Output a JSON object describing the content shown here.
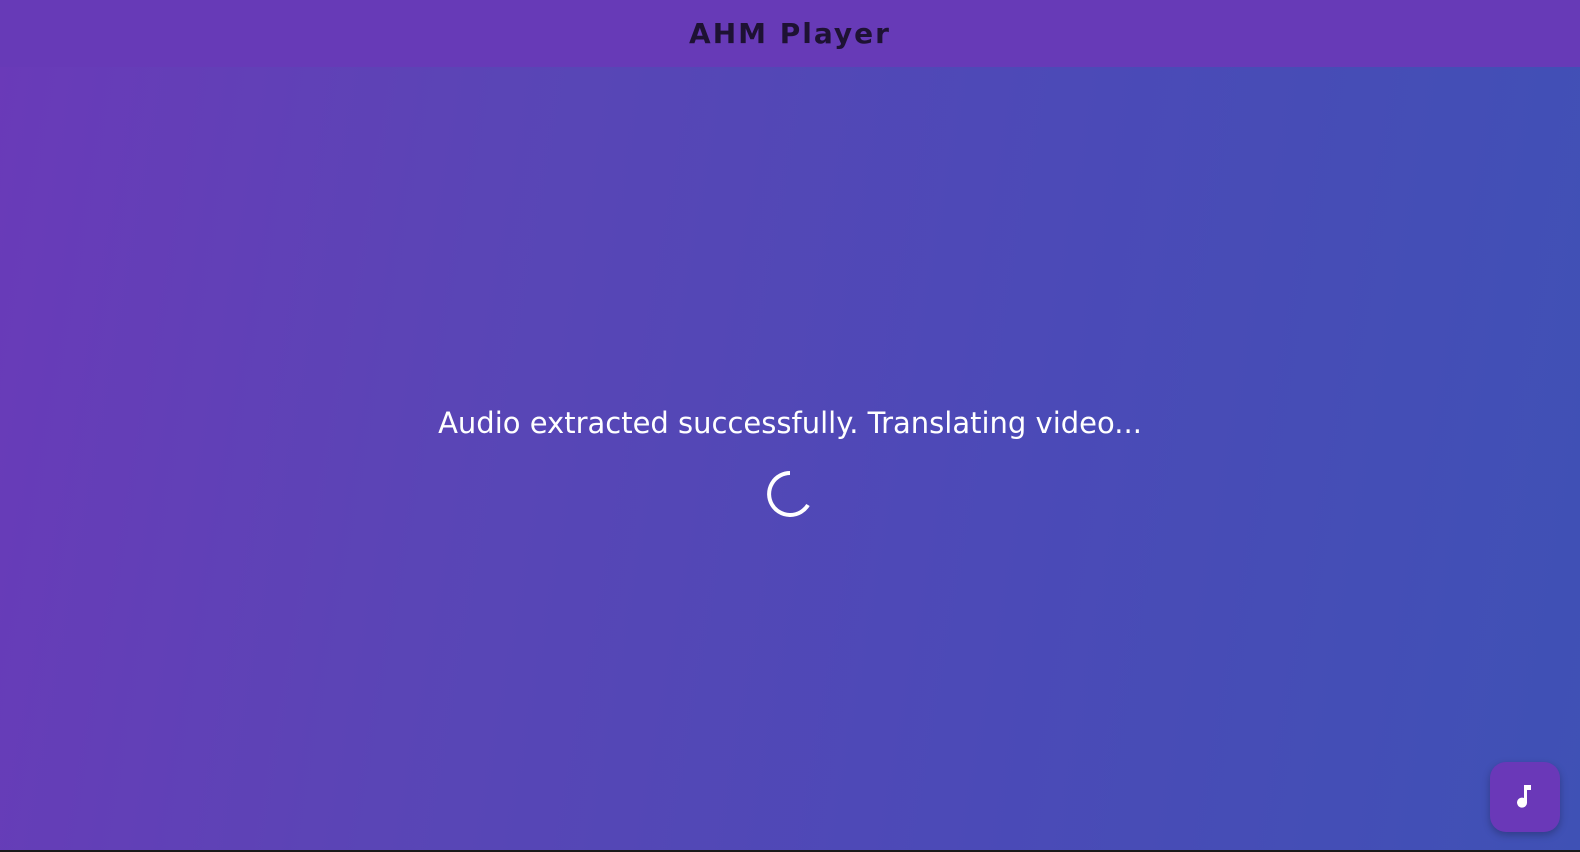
{
  "app_bar": {
    "title": "AHM Player",
    "color": "#673ab7"
  },
  "status": {
    "message": "Audio extracted successfully. Translating video..."
  },
  "spinner": {
    "icon": "loading-spinner-icon"
  },
  "fab": {
    "icon": "music-note-icon",
    "color": "#6a38b8"
  },
  "theme": {
    "gradient_start": "#6a3ab8",
    "gradient_end": "#3f51b5",
    "text_color": "#ffffff"
  }
}
